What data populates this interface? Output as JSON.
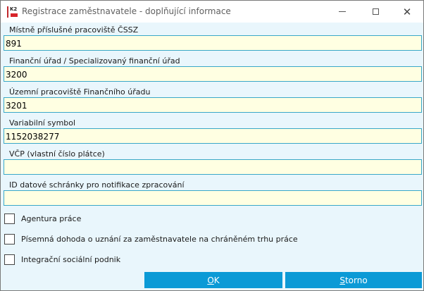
{
  "window": {
    "title": "Registrace zaměstnavatele - doplňující informace",
    "icon": "k2-app-icon",
    "min_icon": "minimize-icon",
    "max_icon": "maximize-icon",
    "close_icon": "close-icon",
    "close_glyph": "✕"
  },
  "fields": [
    {
      "label": "Místně příslušné pracoviště ČSSZ",
      "value": "891"
    },
    {
      "label": "Finanční úřad / Specializovaný finanční úřad",
      "value": "3200"
    },
    {
      "label": "Územní pracoviště Finančního úřadu",
      "value": "3201"
    },
    {
      "label": "Variabilní symbol",
      "value": "1152038277"
    },
    {
      "label": "VČP (vlastní číslo plátce)",
      "value": ""
    },
    {
      "label": "ID datové schránky pro notifikace zpracování",
      "value": ""
    }
  ],
  "checkboxes": [
    {
      "label": "Agentura práce",
      "checked": false
    },
    {
      "label": "Písemná dohoda o uznání za zaměstnavatele na chráněném trhu práce",
      "checked": false
    },
    {
      "label": "Integrační sociální podnik",
      "checked": false
    }
  ],
  "buttons": {
    "ok_label": "OK",
    "cancel_label": "Storno"
  },
  "colors": {
    "background": "#e9f6fc",
    "input_bg": "#ffffe2",
    "input_border": "#3aa8c8",
    "button_bg": "#0b9ad6",
    "button_text": "#ffffff"
  }
}
